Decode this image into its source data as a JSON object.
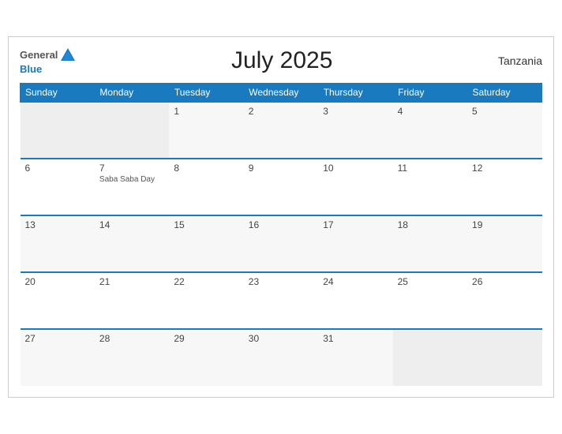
{
  "header": {
    "title": "July 2025",
    "country": "Tanzania",
    "logo_general": "General",
    "logo_blue": "Blue"
  },
  "weekdays": [
    "Sunday",
    "Monday",
    "Tuesday",
    "Wednesday",
    "Thursday",
    "Friday",
    "Saturday"
  ],
  "weeks": [
    [
      {
        "day": "",
        "empty": true
      },
      {
        "day": "",
        "empty": true
      },
      {
        "day": "1",
        "empty": false
      },
      {
        "day": "2",
        "empty": false
      },
      {
        "day": "3",
        "empty": false
      },
      {
        "day": "4",
        "empty": false
      },
      {
        "day": "5",
        "empty": false
      }
    ],
    [
      {
        "day": "6",
        "empty": false
      },
      {
        "day": "7",
        "empty": false,
        "holiday": "Saba Saba Day"
      },
      {
        "day": "8",
        "empty": false
      },
      {
        "day": "9",
        "empty": false
      },
      {
        "day": "10",
        "empty": false
      },
      {
        "day": "11",
        "empty": false
      },
      {
        "day": "12",
        "empty": false
      }
    ],
    [
      {
        "day": "13",
        "empty": false
      },
      {
        "day": "14",
        "empty": false
      },
      {
        "day": "15",
        "empty": false
      },
      {
        "day": "16",
        "empty": false
      },
      {
        "day": "17",
        "empty": false
      },
      {
        "day": "18",
        "empty": false
      },
      {
        "day": "19",
        "empty": false
      }
    ],
    [
      {
        "day": "20",
        "empty": false
      },
      {
        "day": "21",
        "empty": false
      },
      {
        "day": "22",
        "empty": false
      },
      {
        "day": "23",
        "empty": false
      },
      {
        "day": "24",
        "empty": false
      },
      {
        "day": "25",
        "empty": false
      },
      {
        "day": "26",
        "empty": false
      }
    ],
    [
      {
        "day": "27",
        "empty": false
      },
      {
        "day": "28",
        "empty": false
      },
      {
        "day": "29",
        "empty": false
      },
      {
        "day": "30",
        "empty": false
      },
      {
        "day": "31",
        "empty": false
      },
      {
        "day": "",
        "empty": true
      },
      {
        "day": "",
        "empty": true
      }
    ]
  ]
}
